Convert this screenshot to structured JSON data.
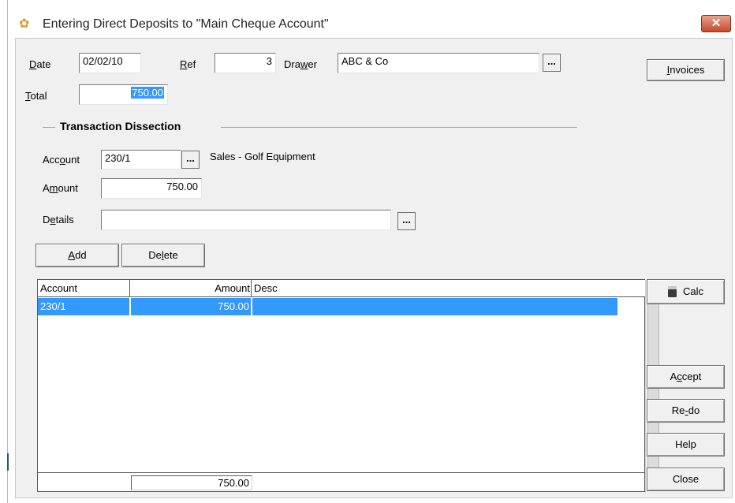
{
  "window": {
    "title": "Entering Direct Deposits to  \"Main Cheque Account\"",
    "close_label": "✕",
    "icon": "app-icon"
  },
  "header": {
    "date_label": "Date",
    "date_value": "02/02/10",
    "ref_label": "Ref",
    "ref_value": "3",
    "drawer_label": "Drawer",
    "drawer_value": "ABC & Co",
    "total_label": "Total",
    "total_value": "750.00",
    "ellipsis": "..."
  },
  "dissection": {
    "title": "Transaction Dissection",
    "account_label": "Account",
    "account_value": "230/1",
    "account_desc": "Sales - Golf Equipment",
    "amount_label": "Amount",
    "amount_value": "750.00",
    "details_label": "Details",
    "details_value": "",
    "add_label": "Add",
    "delete_label": "Delete"
  },
  "grid": {
    "columns": [
      "Account",
      "Amount",
      "Desc"
    ],
    "rows": [
      {
        "account": "230/1",
        "amount": "750.00",
        "desc": ""
      }
    ],
    "footer_total": "750.00"
  },
  "buttons": {
    "invoices": "Invoices",
    "calc": "Calc",
    "accept": "Accept",
    "redo": "Re-do",
    "help": "Help",
    "close": "Close"
  },
  "colors": {
    "selection": "#3399ff",
    "close_button": "#c74a2b"
  }
}
